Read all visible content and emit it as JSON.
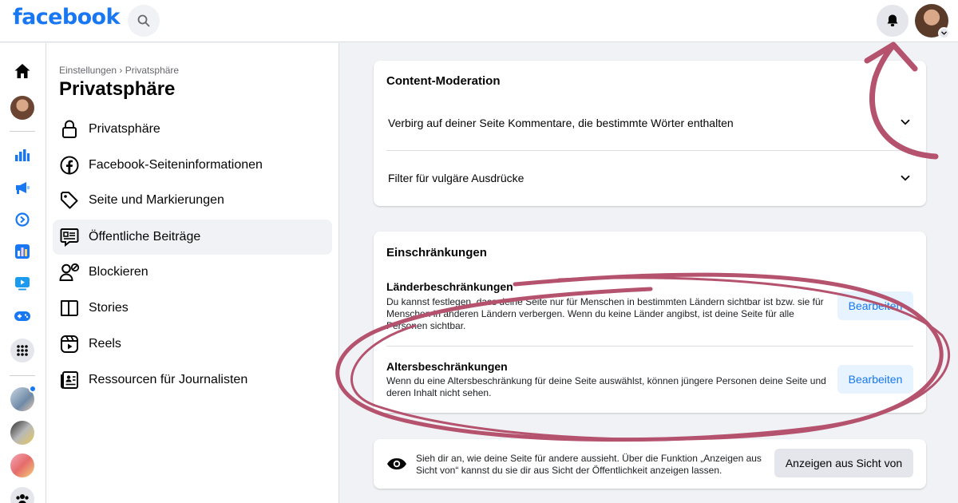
{
  "brand": {
    "logo_text": "facebook",
    "color": "#1877f2"
  },
  "topbar": {
    "search_icon": "search-icon",
    "bell_icon": "bell-icon",
    "profile_icon": "profile-avatar"
  },
  "rail": {
    "items": [
      "home-icon",
      "profile-avatar",
      "insights-icon",
      "ads-icon",
      "meta-business-icon",
      "reports-icon",
      "video-icon",
      "gaming-icon",
      "menu-grid-icon",
      "page-avatar-1",
      "page-avatar-2",
      "page-avatar-3",
      "groups-icon"
    ]
  },
  "sidebar": {
    "breadcrumb": "Einstellungen › Privatsphäre",
    "title": "Privatsphäre",
    "items": [
      {
        "label": "Privatsphäre",
        "icon": "lock-icon"
      },
      {
        "label": "Facebook-Seiteninformationen",
        "icon": "facebook-icon"
      },
      {
        "label": "Seite und Markierungen",
        "icon": "tag-icon"
      },
      {
        "label": "Öffentliche Beiträge",
        "icon": "public-posts-icon",
        "active": true
      },
      {
        "label": "Blockieren",
        "icon": "block-user-icon"
      },
      {
        "label": "Stories",
        "icon": "book-icon"
      },
      {
        "label": "Reels",
        "icon": "reels-icon"
      },
      {
        "label": "Ressourcen für Journalisten",
        "icon": "news-icon"
      }
    ]
  },
  "content_moderation": {
    "title": "Content-Moderation",
    "rows": [
      "Verbirg auf deiner Seite Kommentare, die bestimmte Wörter enthalten",
      "Filter für vulgäre Ausdrücke"
    ]
  },
  "restrictions": {
    "title": "Einschränkungen",
    "country": {
      "title": "Länderbeschränkungen",
      "desc": "Du kannst festlegen, dass deine Seite nur für Menschen in bestimmten Ländern sichtbar ist bzw. sie für Menschen in anderen Ländern verbergen. Wenn du keine Länder angibst, ist deine Seite für alle Personen sichtbar.",
      "button": "Bearbeiten"
    },
    "age": {
      "title": "Altersbeschränkungen",
      "desc": "Wenn du eine Altersbeschränkung für deine Seite auswählst, können jüngere Personen deine Seite und deren Inhalt nicht sehen.",
      "button": "Bearbeiten"
    }
  },
  "view_as": {
    "text": "Sieh dir an, wie deine Seite für andere aussieht. Über die Funktion „Anzeigen aus Sicht von“ kannst du sie dir aus Sicht der Öffentlichkeit anzeigen lassen.",
    "button": "Anzeigen aus Sicht von",
    "icon": "eye-icon"
  },
  "annotation_color": "#b5536f"
}
